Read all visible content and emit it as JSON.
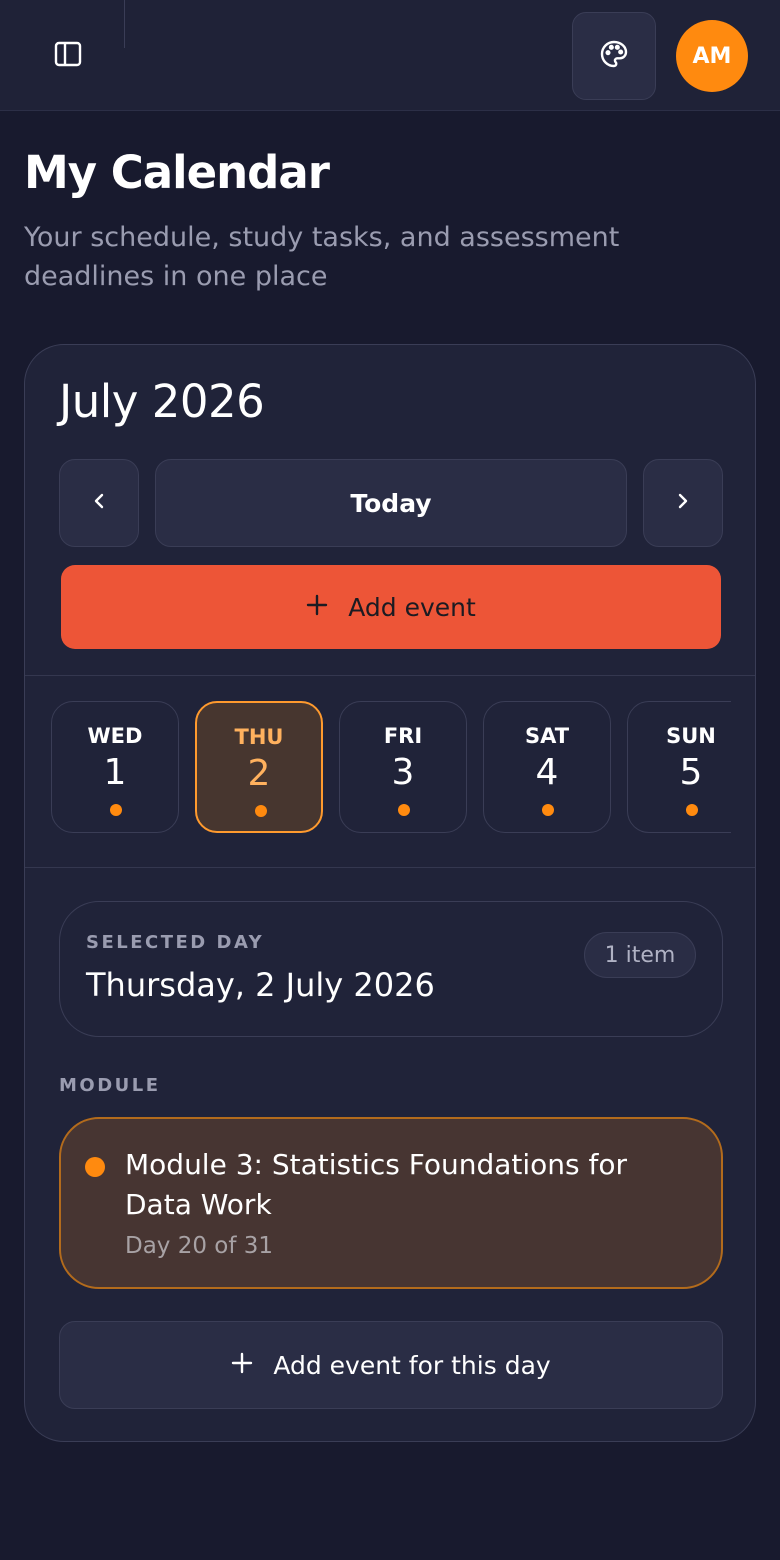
{
  "header": {
    "sidebar_icon": "sidebar-toggle-icon",
    "theme_icon": "palette-icon",
    "avatar_initials": "AM",
    "avatar_color": "#ff8a0f"
  },
  "page": {
    "title": "My Calendar",
    "subtitle": "Your schedule, study tasks, and assessment deadlines in one place"
  },
  "calendar": {
    "month_label": "July 2026",
    "prev_icon": "chevron-left-icon",
    "next_icon": "chevron-right-icon",
    "today_label": "Today",
    "add_event_label": "Add event",
    "accent_color": "#ed5537",
    "days": [
      {
        "name": "WED",
        "num": "1",
        "has_event": true,
        "selected": false
      },
      {
        "name": "THU",
        "num": "2",
        "has_event": true,
        "selected": true
      },
      {
        "name": "FRI",
        "num": "3",
        "has_event": true,
        "selected": false
      },
      {
        "name": "SAT",
        "num": "4",
        "has_event": true,
        "selected": false
      },
      {
        "name": "SUN",
        "num": "5",
        "has_event": true,
        "selected": false
      }
    ]
  },
  "selected_day": {
    "label": "SELECTED DAY",
    "date": "Thursday, 2 July 2026",
    "count": "1 item"
  },
  "events_section": {
    "label": "MODULE",
    "items": [
      {
        "title": "Module 3: Statistics Foundations for Data Work",
        "subtitle": "Day 20 of 31",
        "color": "#ff8a0f"
      }
    ]
  },
  "add_day_label": "Add event for this day"
}
